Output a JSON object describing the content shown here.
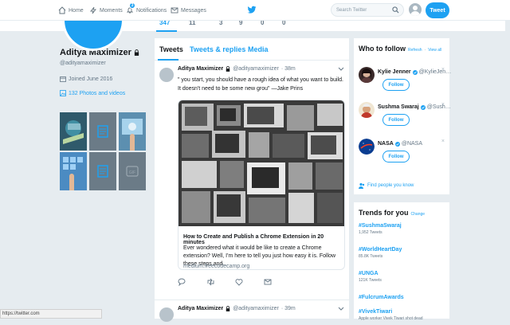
{
  "nav": {
    "home": "Home",
    "moments": "Moments",
    "notifications": "Notifications",
    "notifications_badge": "3",
    "messages": "Messages",
    "search_placeholder": "Search Twitter",
    "tweet_button": "Tweet",
    "brand_color": "#1da1f2"
  },
  "profile_stats": [
    "347",
    "11",
    "3",
    "9",
    "0",
    "0"
  ],
  "profile": {
    "name": "Aditya Maximizer",
    "handle": "@adityamaximizer",
    "joined": "Joined June 2016",
    "photos_videos": "132 Photos and videos"
  },
  "timeline": {
    "tabs": [
      "Tweets",
      "Tweets & replies",
      "Media"
    ],
    "tweets": [
      {
        "name": "Aditya Maximizer",
        "handle": "@adityamaximizer",
        "time": "· 38m",
        "text": "\" you start, you should have a rough idea of what you want to build. It doesn't need to be some new grou\" —Jake Prins",
        "card": {
          "title": "How to Create and Publish a Chrome Extension in 20 minutes",
          "description": "Ever wondered what it would be like to create a Chrome extension? Well, I'm here to tell you just how easy it is. Follow these steps and…",
          "url": "medium.freecodecamp.org"
        }
      },
      {
        "name": "Aditya Maximizer",
        "handle": "@adityamaximizer",
        "time": "· 39m"
      }
    ]
  },
  "who_to_follow": {
    "title": "Who to follow",
    "refresh": "Refresh",
    "view_all": "View all",
    "users": [
      {
        "name": "Kylie Jenner",
        "handle": "@KylieJen…",
        "follow": "Follow"
      },
      {
        "name": "Sushma Swaraj",
        "handle": "@Sush…",
        "follow": "Follow"
      },
      {
        "name": "NASA",
        "handle": "@NASA",
        "follow": "Follow"
      }
    ],
    "find_people": "Find people you know"
  },
  "trends": {
    "title": "Trends for you",
    "change": "Change",
    "items": [
      {
        "name": "#SushmaSwaraj",
        "count": "1,952 Tweets"
      },
      {
        "name": "#WorldHeartDay",
        "count": "85.8K Tweets"
      },
      {
        "name": "#UNGA",
        "count": "121K Tweets"
      },
      {
        "name": "#FulcrumAwards",
        "count": ""
      },
      {
        "name": "#VivekTiwari",
        "count": "Apple worker Vivek Tiwari shot dead"
      }
    ]
  },
  "status_url": "https://twitter.com"
}
